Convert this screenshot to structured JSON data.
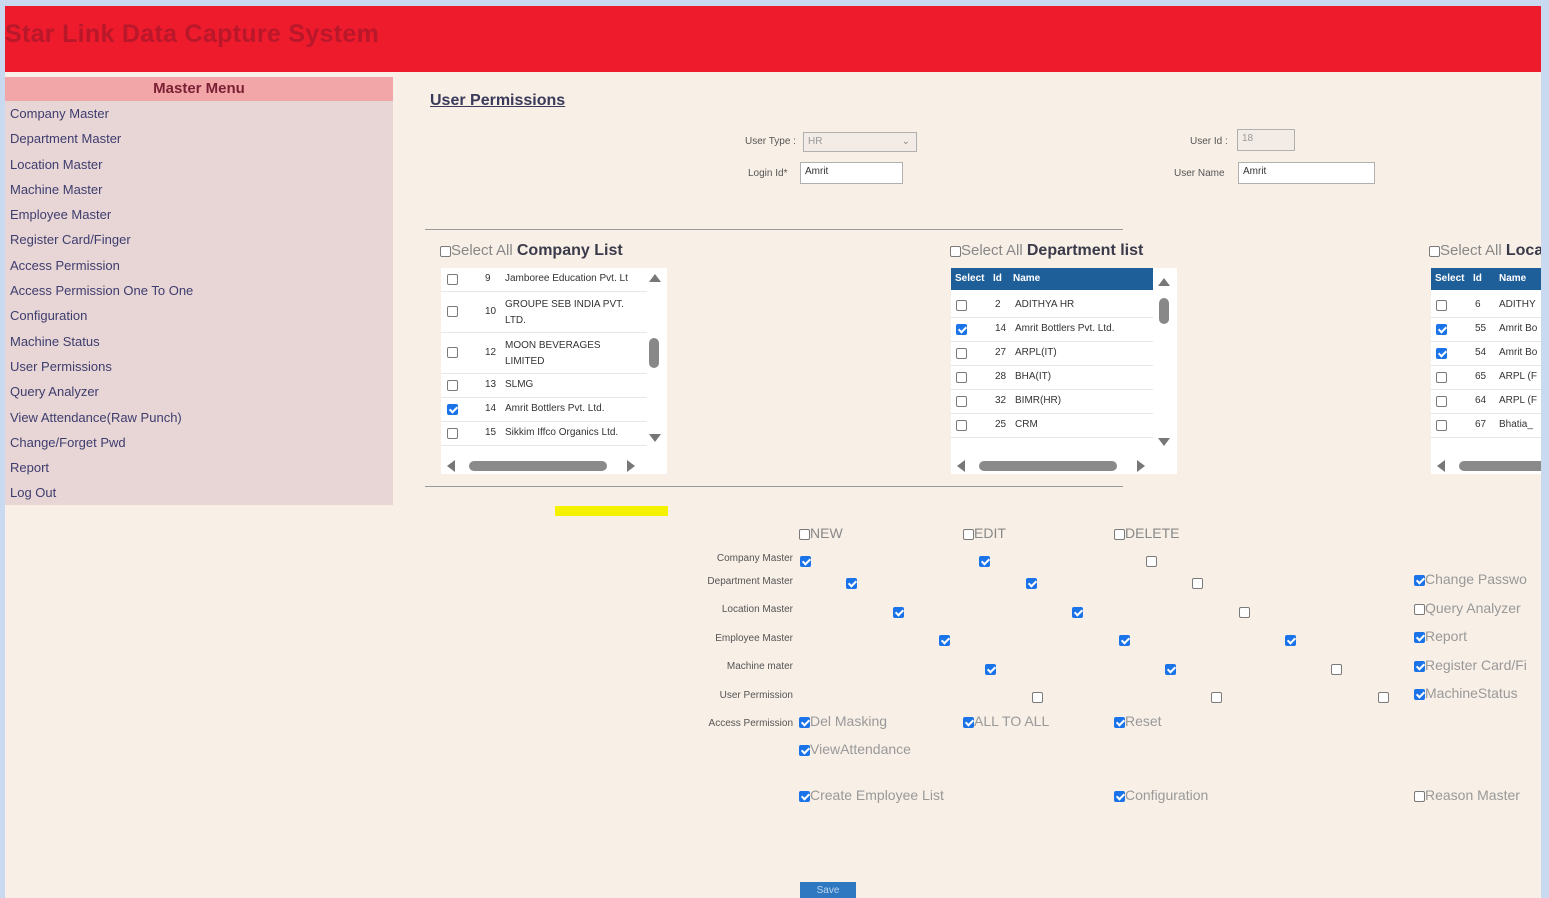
{
  "app": {
    "title": "Star Link Data Capture System"
  },
  "colors": {
    "header": "#ee1b2d",
    "menu_head": "#f3a6a8",
    "check": "#1a73e8",
    "table_head": "#1f5f99"
  },
  "sidebar": {
    "heading": "Master Menu",
    "items": [
      "Company Master",
      "Department Master",
      "Location Master",
      "Machine Master",
      "Employee Master",
      "Register Card/Finger",
      "Access Permission",
      "Access Permission One To One",
      "Configuration",
      "Machine Status",
      "User Permissions",
      "Query Analyzer",
      "View Attendance(Raw Punch)",
      "Change/Forget Pwd",
      "Report",
      "Log Out"
    ]
  },
  "page": {
    "title": "User Permissions"
  },
  "form": {
    "user_type_label": "User Type :",
    "user_type_value": "HR",
    "user_id_label": "User Id :",
    "user_id_value": "18",
    "login_id_label": "Login Id*",
    "login_id_value": "Amrit",
    "user_name_label": "User Name",
    "user_name_value": "Amrit"
  },
  "company_list": {
    "select_all": "Select All",
    "title": "Company List",
    "rows": [
      {
        "checked": false,
        "id": "9",
        "name": "Jamboree Education Pvt. Lt"
      },
      {
        "checked": false,
        "id": "10",
        "name": "GROUPE SEB INDIA PVT. LTD."
      },
      {
        "checked": false,
        "id": "12",
        "name": "MOON BEVERAGES LIMITED"
      },
      {
        "checked": false,
        "id": "13",
        "name": "SLMG"
      },
      {
        "checked": true,
        "id": "14",
        "name": "Amrit Bottlers Pvt. Ltd."
      },
      {
        "checked": false,
        "id": "15",
        "name": "Sikkim Iffco Organics Ltd."
      }
    ]
  },
  "department_list": {
    "select_all": "Select All",
    "title": "Department list",
    "headers": [
      "Select",
      "Id",
      "Name"
    ],
    "rows": [
      {
        "checked": false,
        "id": "2",
        "name": "ADITHYA HR"
      },
      {
        "checked": true,
        "id": "14",
        "name": "Amrit Bottlers Pvt. Ltd."
      },
      {
        "checked": false,
        "id": "27",
        "name": "ARPL(IT)"
      },
      {
        "checked": false,
        "id": "28",
        "name": "BHA(IT)"
      },
      {
        "checked": false,
        "id": "32",
        "name": "BIMR(HR)"
      },
      {
        "checked": false,
        "id": "25",
        "name": "CRM"
      }
    ]
  },
  "location_list": {
    "select_all": "Select All",
    "title": "Loca",
    "headers": [
      "Select",
      "Id",
      "Name"
    ],
    "rows": [
      {
        "checked": false,
        "id": "6",
        "name": "ADITHY"
      },
      {
        "checked": true,
        "id": "55",
        "name": "Amrit Bo"
      },
      {
        "checked": true,
        "id": "54",
        "name": "Amrit Bo"
      },
      {
        "checked": false,
        "id": "65",
        "name": "ARPL (F"
      },
      {
        "checked": false,
        "id": "64",
        "name": "ARPL (F"
      },
      {
        "checked": false,
        "id": "67",
        "name": "Bhatia_"
      }
    ]
  },
  "permissions": {
    "columns": [
      "NEW",
      "EDIT",
      "DELETE"
    ],
    "rows": [
      {
        "label": "Company Master",
        "new": true,
        "edit": true,
        "delete": false
      },
      {
        "label": "Department Master",
        "new": true,
        "edit": true,
        "delete": false
      },
      {
        "label": "Location Master",
        "new": true,
        "edit": true,
        "delete": false
      },
      {
        "label": "Employee Master",
        "new": true,
        "edit": true,
        "delete": true
      },
      {
        "label": "Machine mater",
        "new": true,
        "edit": true,
        "delete": false
      },
      {
        "label": "User Permission",
        "new": false,
        "edit": false,
        "delete": false
      },
      {
        "label": "Access Permission",
        "new": true,
        "edit": true,
        "delete": true
      }
    ],
    "inline_options": {
      "del_masking": "Del Masking",
      "all_to_all": "ALL TO ALL",
      "reset": "Reset",
      "view_attendance": "ViewAttendance"
    },
    "right_options": [
      {
        "label": "Change Passwo",
        "checked": true
      },
      {
        "label": "Query Analyzer",
        "checked": false
      },
      {
        "label": "Report",
        "checked": true
      },
      {
        "label": "Register Card/Fi",
        "checked": true
      },
      {
        "label": "MachineStatus",
        "checked": true
      }
    ],
    "bottom_options": [
      {
        "label": "Create Employee List",
        "checked": true
      },
      {
        "label": "Configuration",
        "checked": true
      },
      {
        "label": "Reason Master",
        "checked": false
      }
    ]
  },
  "save_label": "Save"
}
